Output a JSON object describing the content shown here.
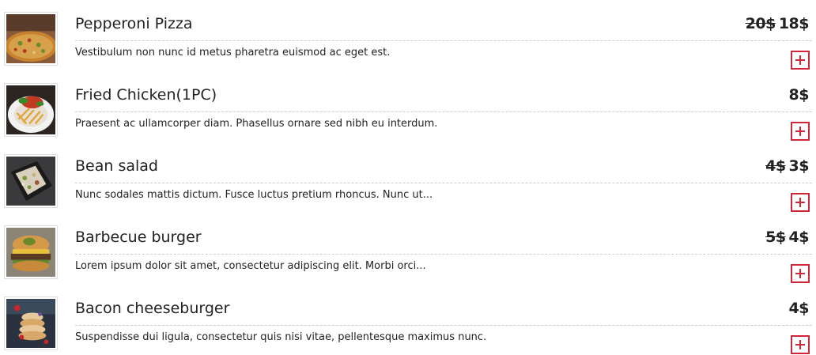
{
  "menu": {
    "items": [
      {
        "name": "Pepperoni Pizza",
        "old_price": "20$",
        "price": "18$",
        "description": "Vestibulum non nunc id metus pharetra euismod ac eget est.",
        "image_icon": "pizza-photo"
      },
      {
        "name": "Fried Chicken(1PC)",
        "old_price": "",
        "price": "8$",
        "description": "Praesent ac ullamcorper diam. Phasellus ornare sed nibh eu interdum.",
        "image_icon": "fried-chicken-photo"
      },
      {
        "name": "Bean salad",
        "old_price": "4$",
        "price": "3$",
        "description": "Nunc sodales mattis dictum. Fusce luctus pretium rhoncus. Nunc ut...",
        "image_icon": "salad-photo"
      },
      {
        "name": "Barbecue burger",
        "old_price": "5$",
        "price": "4$",
        "description": "Lorem ipsum dolor sit amet, consectetur adipiscing elit. Morbi orci...",
        "image_icon": "burger-photo"
      },
      {
        "name": "Bacon cheeseburger",
        "old_price": "",
        "price": "4$",
        "description": "Suspendisse dui ligula, consectetur quis nisi vitae, pellentesque maximus nunc.",
        "image_icon": "cheeseburger-photo"
      }
    ]
  },
  "colors": {
    "accent": "#d0263a",
    "text": "#222222",
    "divider": "#cccccc"
  }
}
